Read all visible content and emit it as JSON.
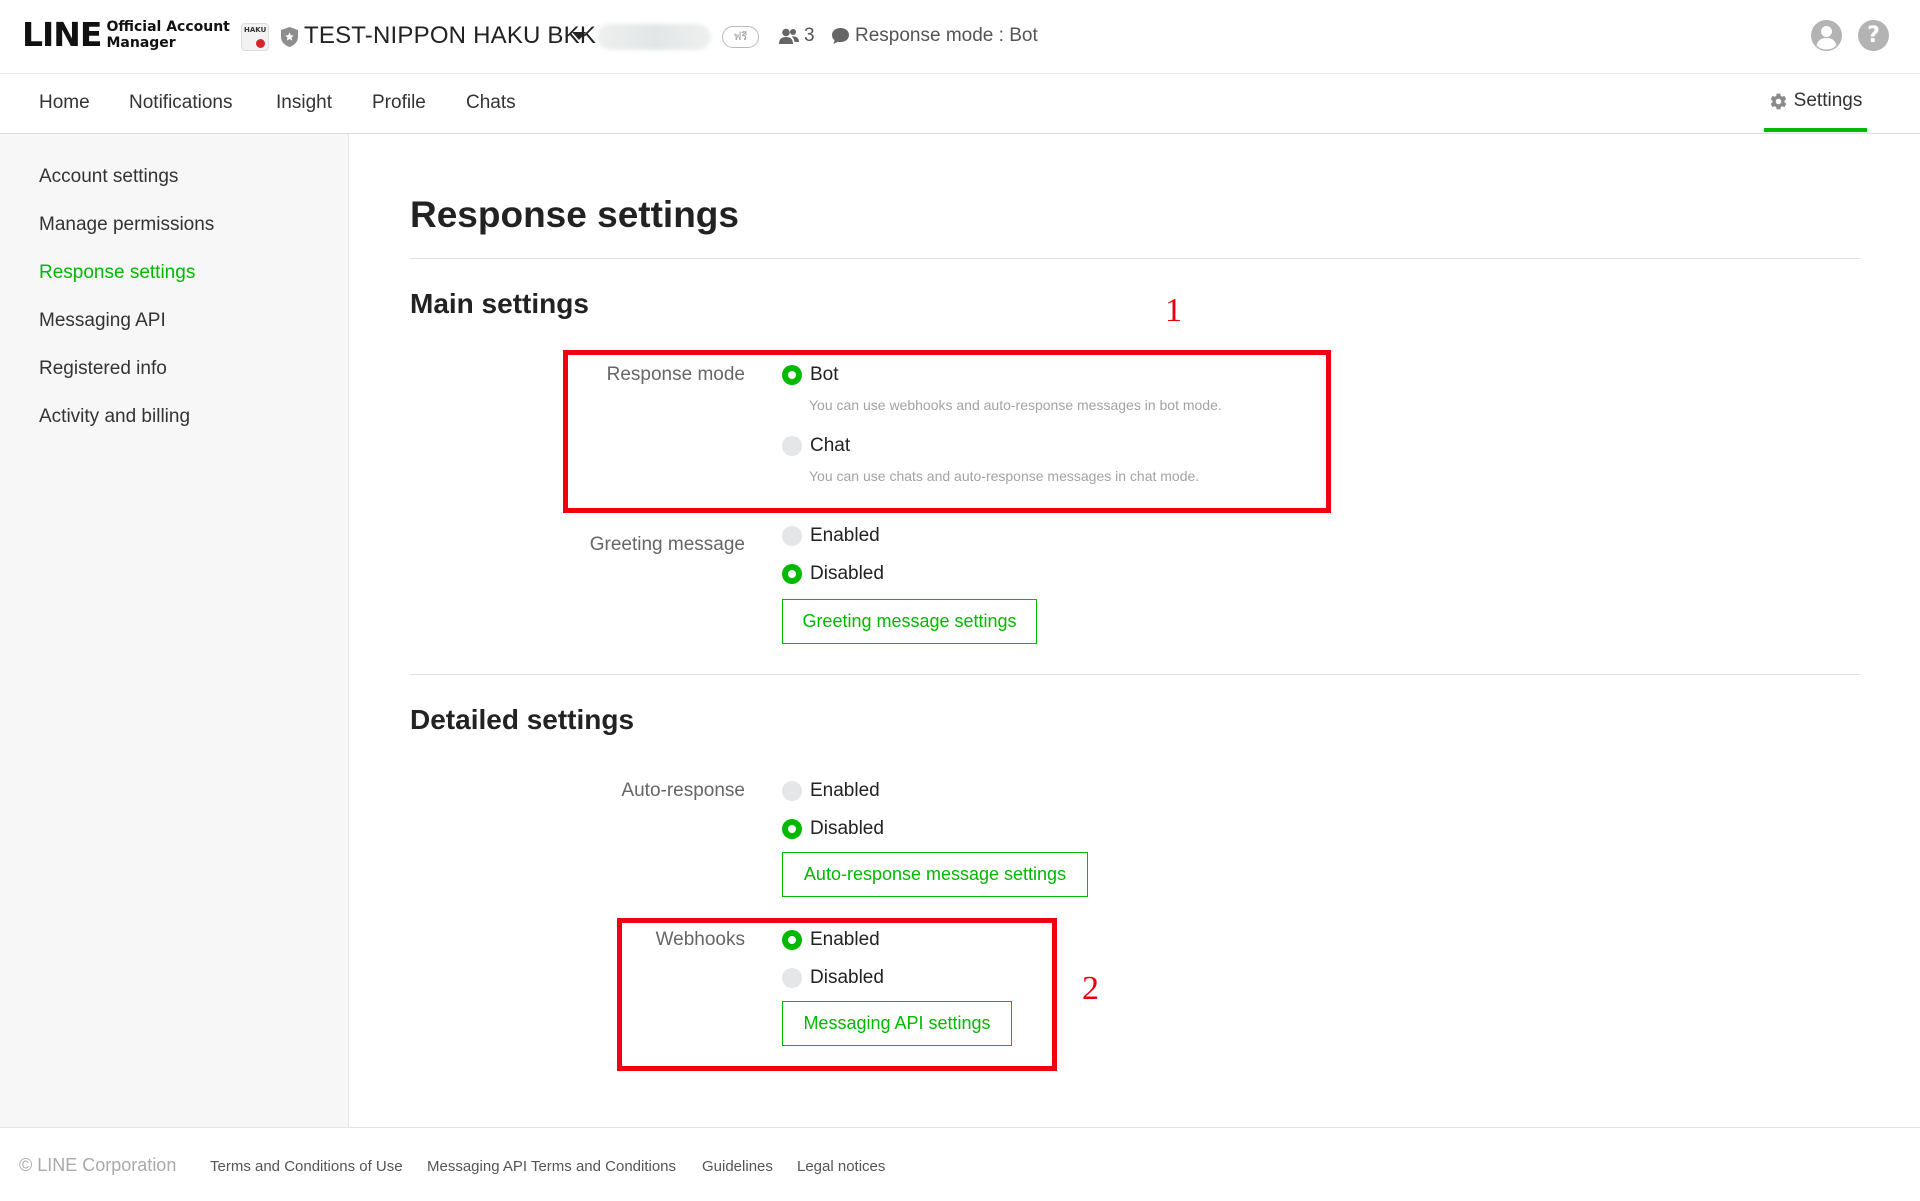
{
  "header": {
    "logo_word": "LINE",
    "logo_sub_1": "Official Account",
    "logo_sub_2": "Manager",
    "account_avatar_text": "HAKU",
    "account_name": "TEST-NIPPON HAKU BKK",
    "plan_badge": "ฟรี",
    "friends_count": "3",
    "response_mode": "Response mode : Bot"
  },
  "nav": {
    "tabs": [
      "Home",
      "Notifications",
      "Insight",
      "Profile",
      "Chats"
    ],
    "settings": "Settings"
  },
  "sidebar": {
    "items": [
      "Account settings",
      "Manage permissions",
      "Response settings",
      "Messaging API",
      "Registered info",
      "Activity and billing"
    ],
    "active_index": 2
  },
  "main": {
    "title": "Response settings",
    "main_settings": {
      "title": "Main settings",
      "response_mode": {
        "label": "Response mode",
        "options": [
          {
            "label": "Bot",
            "description": "You can use webhooks and auto-response messages in bot mode.",
            "selected": true
          },
          {
            "label": "Chat",
            "description": "You can use chats and auto-response messages in chat mode.",
            "selected": false
          }
        ]
      },
      "greeting": {
        "label": "Greeting message",
        "options": [
          {
            "label": "Enabled",
            "selected": false
          },
          {
            "label": "Disabled",
            "selected": true
          }
        ],
        "button": "Greeting message settings"
      }
    },
    "detailed_settings": {
      "title": "Detailed settings",
      "auto_response": {
        "label": "Auto-response",
        "options": [
          {
            "label": "Enabled",
            "selected": false
          },
          {
            "label": "Disabled",
            "selected": true
          }
        ],
        "button": "Auto-response message settings"
      },
      "webhooks": {
        "label": "Webhooks",
        "options": [
          {
            "label": "Enabled",
            "selected": true
          },
          {
            "label": "Disabled",
            "selected": false
          }
        ],
        "button": "Messaging API settings"
      }
    },
    "annotations": [
      "1",
      "2"
    ]
  },
  "footer": {
    "copyright": "© LINE Corporation",
    "links": [
      "Terms and Conditions of Use",
      "Messaging API Terms and Conditions",
      "Guidelines",
      "Legal notices"
    ]
  },
  "colors": {
    "accent": "#00b900",
    "annotation": "#f2000f"
  }
}
